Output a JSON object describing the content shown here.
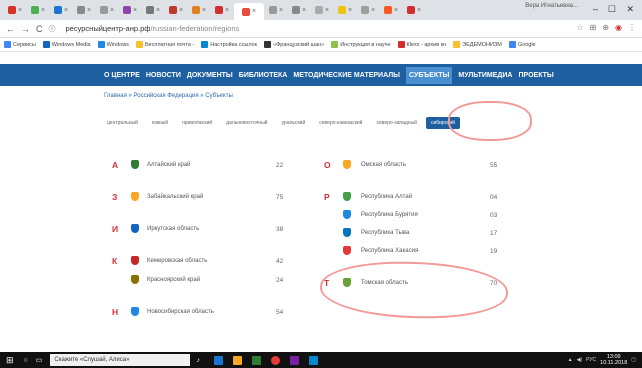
{
  "browser": {
    "tabs": [
      {
        "label": "M",
        "color": "#d93025"
      },
      {
        "label": "",
        "color": "#4caf50"
      },
      {
        "label": "",
        "color": "#1976d2"
      },
      {
        "label": "",
        "color": "#888888"
      },
      {
        "label": "",
        "color": "#999999"
      },
      {
        "label": "",
        "color": "#8e44ad"
      },
      {
        "label": "",
        "color": "#777777"
      },
      {
        "label": "",
        "color": "#c0392b"
      },
      {
        "label": "",
        "color": "#e67e22"
      },
      {
        "label": "",
        "color": "#d32f2f"
      },
      {
        "label": "",
        "color": "#e74c3c"
      },
      {
        "label": "",
        "color": "#999999"
      },
      {
        "label": "",
        "color": "#888888"
      },
      {
        "label": "",
        "color": "#aaaaaa"
      },
      {
        "label": "",
        "color": "#f1c40f"
      },
      {
        "label": "",
        "color": "#9e9e9e"
      },
      {
        "label": "",
        "color": "#ff5722"
      },
      {
        "label": "",
        "color": "#d32f2f"
      }
    ],
    "user": "Вера Игнатьевна...",
    "url_domain": "ресурсныйцентр-анр.рф",
    "url_path": "/russian-federation/regions",
    "bookmarks": [
      {
        "label": "Сервисы",
        "color": "#4285f4"
      },
      {
        "label": "Windows Media",
        "color": "#1565c0"
      },
      {
        "label": "Windows",
        "color": "#1e88e5"
      },
      {
        "label": "Бесплатная почта -",
        "color": "#fbc02d"
      },
      {
        "label": "Настройка ссылок",
        "color": "#0288d1"
      },
      {
        "label": "«Французский шан»",
        "color": "#333333"
      },
      {
        "label": "Инструкция в научн",
        "color": "#8bc34a"
      },
      {
        "label": "Кleхх - архив кн",
        "color": "#d32f2f"
      },
      {
        "label": "ЭЕДЕМОНИЗМ",
        "color": "#fbc02d"
      },
      {
        "label": "Google",
        "color": "#4285f4"
      }
    ]
  },
  "site": {
    "nav": [
      "О ЦЕНТРЕ",
      "НОВОСТИ",
      "ДОКУМЕНТЫ",
      "БИБЛИОТЕКА",
      "МЕТОДИЧЕСКИЕ МАТЕРИАЛЫ",
      "СУБЪЕКТЫ",
      "МУЛЬТИМЕДИА",
      "ПРОЕКТЫ"
    ],
    "nav_selected": 5,
    "breadcrumb": "Главная » Российская Федерация » Субъекты",
    "districts": [
      "центральный",
      "южный",
      "приволжский",
      "дальневосточный",
      "уральский",
      "северо-кавказский",
      "северо-западный",
      "сибирский"
    ],
    "district_selected": 7,
    "regions_left": [
      {
        "letter": "А",
        "name": "Алтайский край",
        "code": "22",
        "color": "#2e7d32"
      },
      {
        "letter": "З",
        "name": "Забайкальский край",
        "code": "75",
        "color": "#f9a825"
      },
      {
        "letter": "И",
        "name": "Иркутская область",
        "code": "38",
        "color": "#1565c0"
      },
      {
        "letter": "К",
        "name": "Кемеровская область",
        "code": "42",
        "color": "#c62828"
      },
      {
        "letter": "",
        "name": "Красноярский край",
        "code": "24",
        "color": "#8d6e00"
      },
      {
        "letter": "Н",
        "name": "Новосибирская область",
        "code": "54",
        "color": "#1e88e5"
      }
    ],
    "regions_right": [
      {
        "letter": "О",
        "name": "Омская область",
        "code": "55",
        "color": "#f9a825"
      },
      {
        "letter": "Р",
        "name": "Республика Алтай",
        "code": "04",
        "color": "#43a047"
      },
      {
        "letter": "",
        "name": "Республика Бурятия",
        "code": "03",
        "color": "#1e88e5"
      },
      {
        "letter": "",
        "name": "Республика Тыва",
        "code": "17",
        "color": "#0277bd"
      },
      {
        "letter": "",
        "name": "Республика Хакасия",
        "code": "19",
        "color": "#e53935"
      },
      {
        "letter": "Т",
        "name": "Томская область",
        "code": "70",
        "color": "#689f38"
      }
    ]
  },
  "taskbar": {
    "search": "Скажите «Слушай, Алиса»",
    "time": "13:09",
    "date": "10.11.2018",
    "lang": "РУС"
  }
}
